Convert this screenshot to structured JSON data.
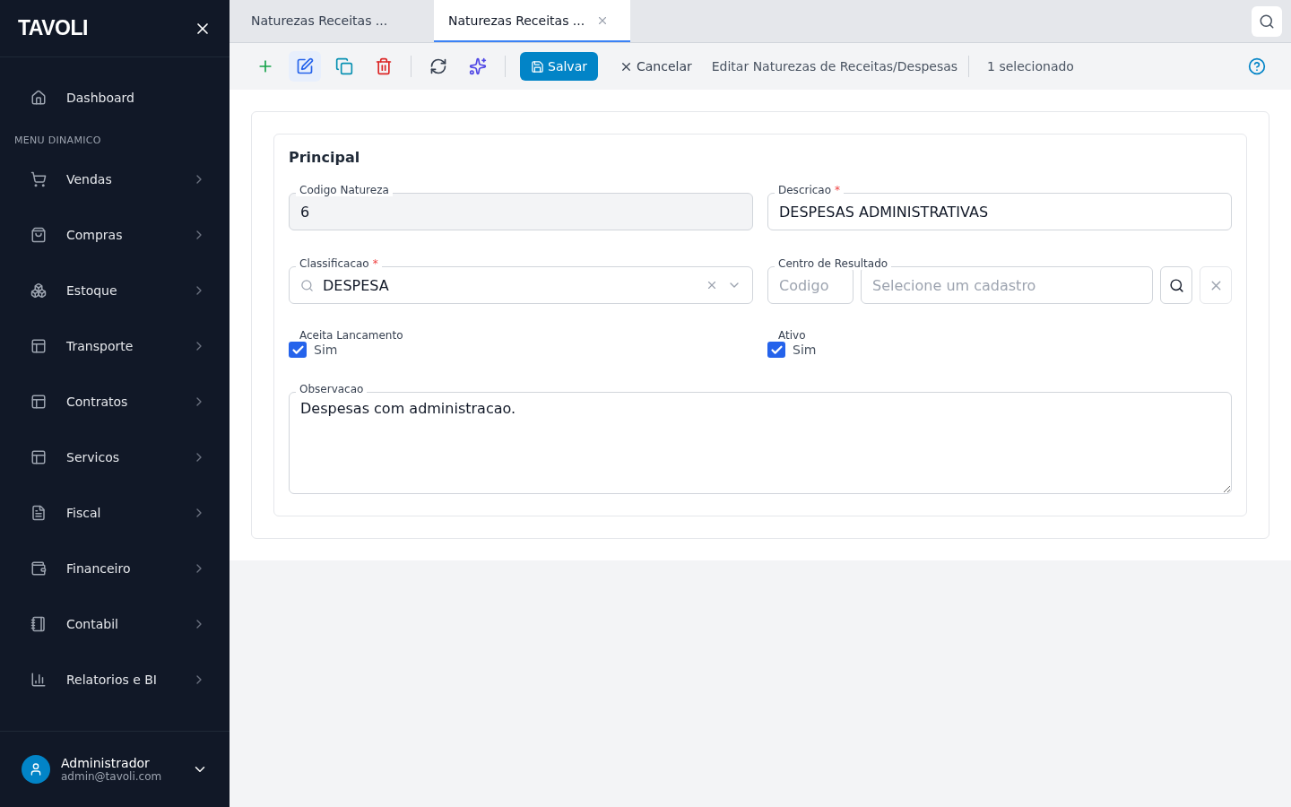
{
  "sidebar": {
    "logo": "TAVOLI",
    "home": {
      "label": "Dashboard"
    },
    "section": "MENU DINAMICO",
    "items": [
      {
        "label": "Vendas"
      },
      {
        "label": "Compras"
      },
      {
        "label": "Estoque"
      },
      {
        "label": "Transporte"
      },
      {
        "label": "Contratos"
      },
      {
        "label": "Servicos"
      },
      {
        "label": "Fiscal"
      },
      {
        "label": "Financeiro"
      },
      {
        "label": "Contabil"
      },
      {
        "label": "Relatorios e BI"
      }
    ],
    "user": {
      "name": "Administrador",
      "email": "admin@tavoli.com"
    }
  },
  "tabs": [
    {
      "label": "Naturezas Receitas ...",
      "selected": false
    },
    {
      "label": "Naturezas Receitas ...",
      "selected": true
    }
  ],
  "toolbar": {
    "save": "Salvar",
    "cancel": "Cancelar",
    "title": "Editar Naturezas de Receitas/Despesas",
    "selection": "1 selecionado"
  },
  "form": {
    "section": "Principal",
    "codigo": {
      "label": "Codigo Natureza",
      "value": "6",
      "disabled": true
    },
    "descricao": {
      "label": "Descricao",
      "required_mark": "*",
      "value": "DESPESAS ADMINISTRATIVAS"
    },
    "classificacao": {
      "label": "Classificacao",
      "required_mark": "*",
      "value": "DESPESA"
    },
    "centro": {
      "label": "Centro de Resultado",
      "code_placeholder": "Codigo",
      "placeholder": "Selecione um cadastro"
    },
    "checks": [
      {
        "label": "Aceita Lancamento",
        "option": "Sim",
        "checked": true
      },
      {
        "label": "Ativo",
        "option": "Sim",
        "checked": true
      }
    ],
    "observacao": {
      "label": "Observacao",
      "value": "Despesas com administracao."
    }
  }
}
